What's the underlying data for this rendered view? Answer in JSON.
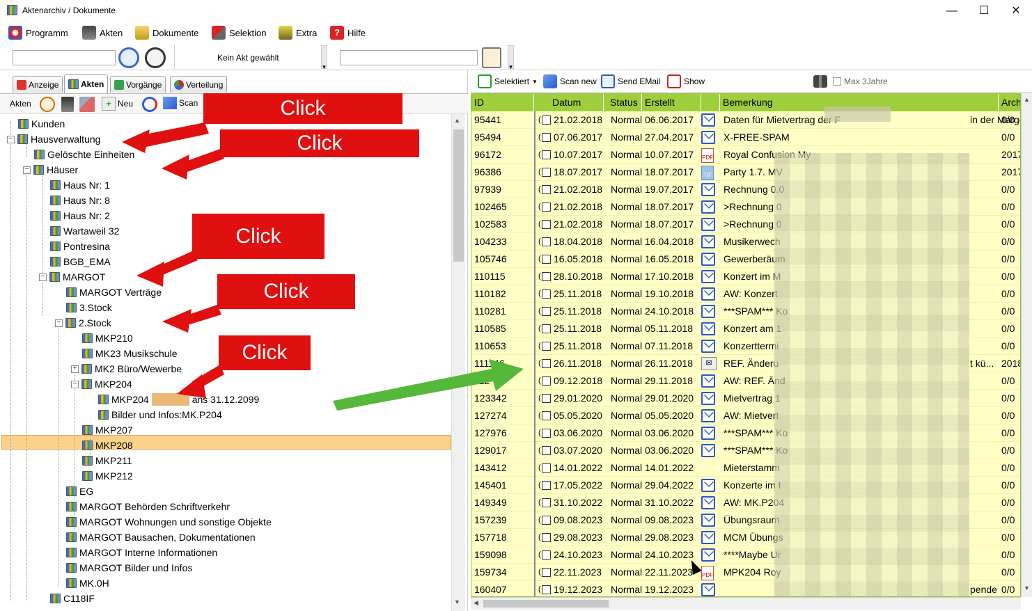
{
  "window": {
    "title": "Aktenarchiv / Dokumente",
    "min": "—",
    "max": "☐",
    "close": "✕"
  },
  "menu": [
    {
      "label": "Programm"
    },
    {
      "label": "Akten"
    },
    {
      "label": "Dokumente"
    },
    {
      "label": "Selektion"
    },
    {
      "label": "Extra"
    },
    {
      "label": "Hilfe"
    }
  ],
  "toolbar": {
    "akt_status": "Kein Akt gewählt"
  },
  "left_tabs": [
    "Anzeige",
    "Akten",
    "Vorgänge",
    "Verteilung"
  ],
  "left_subtool": {
    "akten_label": "Akten",
    "neu_label": "Neu",
    "scan_label": "Scan"
  },
  "tree": [
    {
      "label": "Kunden"
    },
    {
      "label": "Hausverwaltung"
    },
    {
      "label": "Gelöschte Einheiten"
    },
    {
      "label": "Häuser"
    },
    {
      "label": "Haus Nr:  1"
    },
    {
      "label": "Haus Nr:  8"
    },
    {
      "label": "Haus Nr:  2"
    },
    {
      "label": "Wartaweil 32"
    },
    {
      "label": "Pontresina"
    },
    {
      "label": "BGB_EMA"
    },
    {
      "label": "MARGOT"
    },
    {
      "label": "MARGOT Verträge"
    },
    {
      "label": "3.Stock"
    },
    {
      "label": "2.Stock"
    },
    {
      "label": "MKP210"
    },
    {
      "label": "MK23 Musikschule"
    },
    {
      "label": "MK2 Büro/Wewerbe"
    },
    {
      "label": "MKP204"
    },
    {
      "label": "MKP204"
    },
    {
      "label": "Bilder und Infos:MK.P204"
    },
    {
      "label": "MKP207"
    },
    {
      "label": "MKP208"
    },
    {
      "label": "MKP211"
    },
    {
      "label": "MKP212"
    },
    {
      "label": "EG"
    },
    {
      "label": "MARGOT Behörden Schriftverkehr"
    },
    {
      "label": "MARGOT Wohnungen und sonstige Objekte"
    },
    {
      "label": "MARGOT Bausachen, Dokumentationen"
    },
    {
      "label": "MARGOT Interne Informationen"
    },
    {
      "label": "MARGOT Bilder und Infos"
    },
    {
      "label": "MK.0H"
    },
    {
      "label": "C118IF"
    }
  ],
  "tree_selected_suffix": "ans 31.12.2099",
  "right_toolbar": {
    "selektiert": "Selektiert",
    "scan_new": "Scan new",
    "send_email": "Send EMail",
    "show": "Show",
    "max3": "Max 3Jahre"
  },
  "grid": {
    "columns": [
      "ID",
      "Datum",
      "Status",
      "Erstellt",
      "Bemerkung",
      "Arch"
    ],
    "rows": [
      [
        "95441",
        "21.02.2018",
        "Normal",
        "06.06.2017",
        "mail",
        "Daten für Mietvertrag der F",
        "in der Margot-Kalinke-...",
        "0/0"
      ],
      [
        "95494",
        "07.06.2017",
        "Normal",
        "27.04.2017",
        "mail",
        "X-FREE-SPAM",
        "",
        "0/0"
      ],
      [
        "96172",
        "10.07.2017",
        "Normal",
        "10.07.2017",
        "pdf",
        "Royal Confusion My",
        "",
        "2017"
      ],
      [
        "96386",
        "18.07.2017",
        "Normal",
        "18.07.2017",
        "tif",
        "Party 1.7. MV",
        "",
        "2017"
      ],
      [
        "97939",
        "21.02.2018",
        "Normal",
        "19.07.2017",
        "mail",
        "Rechnung 0.0",
        "",
        "0/0"
      ],
      [
        "102465",
        "21.02.2018",
        "Normal",
        "18.07.2017",
        "mail",
        ">Rechnung 0",
        "",
        "0/0"
      ],
      [
        "102583",
        "21.02.2018",
        "Normal",
        "18.07.2017",
        "mail",
        ">Rechnung 0",
        "",
        "0/0"
      ],
      [
        "104233",
        "18.04.2018",
        "Normal",
        "16.04.2018",
        "mail",
        "Musikerwech",
        "",
        "0/0"
      ],
      [
        "105746",
        "16.05.2018",
        "Normal",
        "16.05.2018",
        "mail",
        "Gewerberäum",
        "",
        "0/0"
      ],
      [
        "110115",
        "28.10.2018",
        "Normal",
        "17.10.2018",
        "mail",
        "Konzert im M",
        "",
        "0/0"
      ],
      [
        "110182",
        "25.11.2018",
        "Normal",
        "19.10.2018",
        "mail",
        "AW: Konzert",
        "",
        "0/0"
      ],
      [
        "110281",
        "25.11.2018",
        "Normal",
        "24.10.2018",
        "mail",
        "***SPAM*** Ko",
        "",
        "0/0"
      ],
      [
        "110585",
        "25.11.2018",
        "Normal",
        "05.11.2018",
        "mail",
        "Konzert am 1",
        "",
        "0/0"
      ],
      [
        "110653",
        "25.11.2018",
        "Normal",
        "07.11.2018",
        "mail",
        "Konzerttermi",
        "",
        "0/0"
      ],
      [
        "111146",
        "26.11.2018",
        "Normal",
        "26.11.2018",
        "env",
        "REF. Änderu",
        "t kü...",
        "2018"
      ],
      [
        "112",
        "09.12.2018",
        "Normal",
        "29.11.2018",
        "mail",
        "AW: REF. Änd",
        "",
        "0/0"
      ],
      [
        "123342",
        "29.01.2020",
        "Normal",
        "29.01.2020",
        "mail",
        "Mietvertrag 1",
        "",
        "0/0"
      ],
      [
        "127274",
        "05.05.2020",
        "Normal",
        "05.05.2020",
        "mail",
        "AW: Mietvert",
        "",
        "0/0"
      ],
      [
        "127976",
        "03.06.2020",
        "Normal",
        "03.06.2020",
        "mail",
        "***SPAM*** Ko",
        "",
        "0/0"
      ],
      [
        "129017",
        "03.07.2020",
        "Normal",
        "03.06.2020",
        "mail",
        "***SPAM*** Ko",
        "",
        "0/0"
      ],
      [
        "143412",
        "14.01.2022",
        "Normal",
        "14.01.2022",
        "",
        "Mieterstamm",
        "",
        "0/0"
      ],
      [
        "145401",
        "17.05.2022",
        "Normal",
        "29.04.2022",
        "mail",
        "Konzerte im I",
        "",
        "0/0"
      ],
      [
        "149349",
        "31.10.2022",
        "Normal",
        "31.10.2022",
        "mail",
        "AW: MK.P204",
        "",
        "0/0"
      ],
      [
        "157239",
        "09.08.2023",
        "Normal",
        "09.08.2023",
        "mail",
        "Übungsraum",
        "",
        "0/0"
      ],
      [
        "157718",
        "29.08.2023",
        "Normal",
        "29.08.2023",
        "mail",
        "MCM Übungs",
        "",
        "0/0"
      ],
      [
        "159098",
        "24.10.2023",
        "Normal",
        "24.10.2023",
        "mail",
        "****Maybe Ur",
        "",
        "0/0"
      ],
      [
        "159734",
        "22.11.2023",
        "Normal",
        "22.11.2023",
        "pdf",
        "MPK204 Roy",
        "",
        "0/0"
      ],
      [
        "160407",
        "19.12.2023",
        "Normal",
        "19.12.2023",
        "mail",
        "",
        "pende",
        "0/0"
      ]
    ]
  },
  "callouts": [
    "Click",
    "Click",
    "Click",
    "Click",
    "Click"
  ],
  "colors": {
    "grid_bg": "#ffffc5",
    "grid_header": "#9fce3c",
    "callout": "#e01010",
    "arrow_green": "#55b83a",
    "selected_row": "#fcd28a"
  }
}
